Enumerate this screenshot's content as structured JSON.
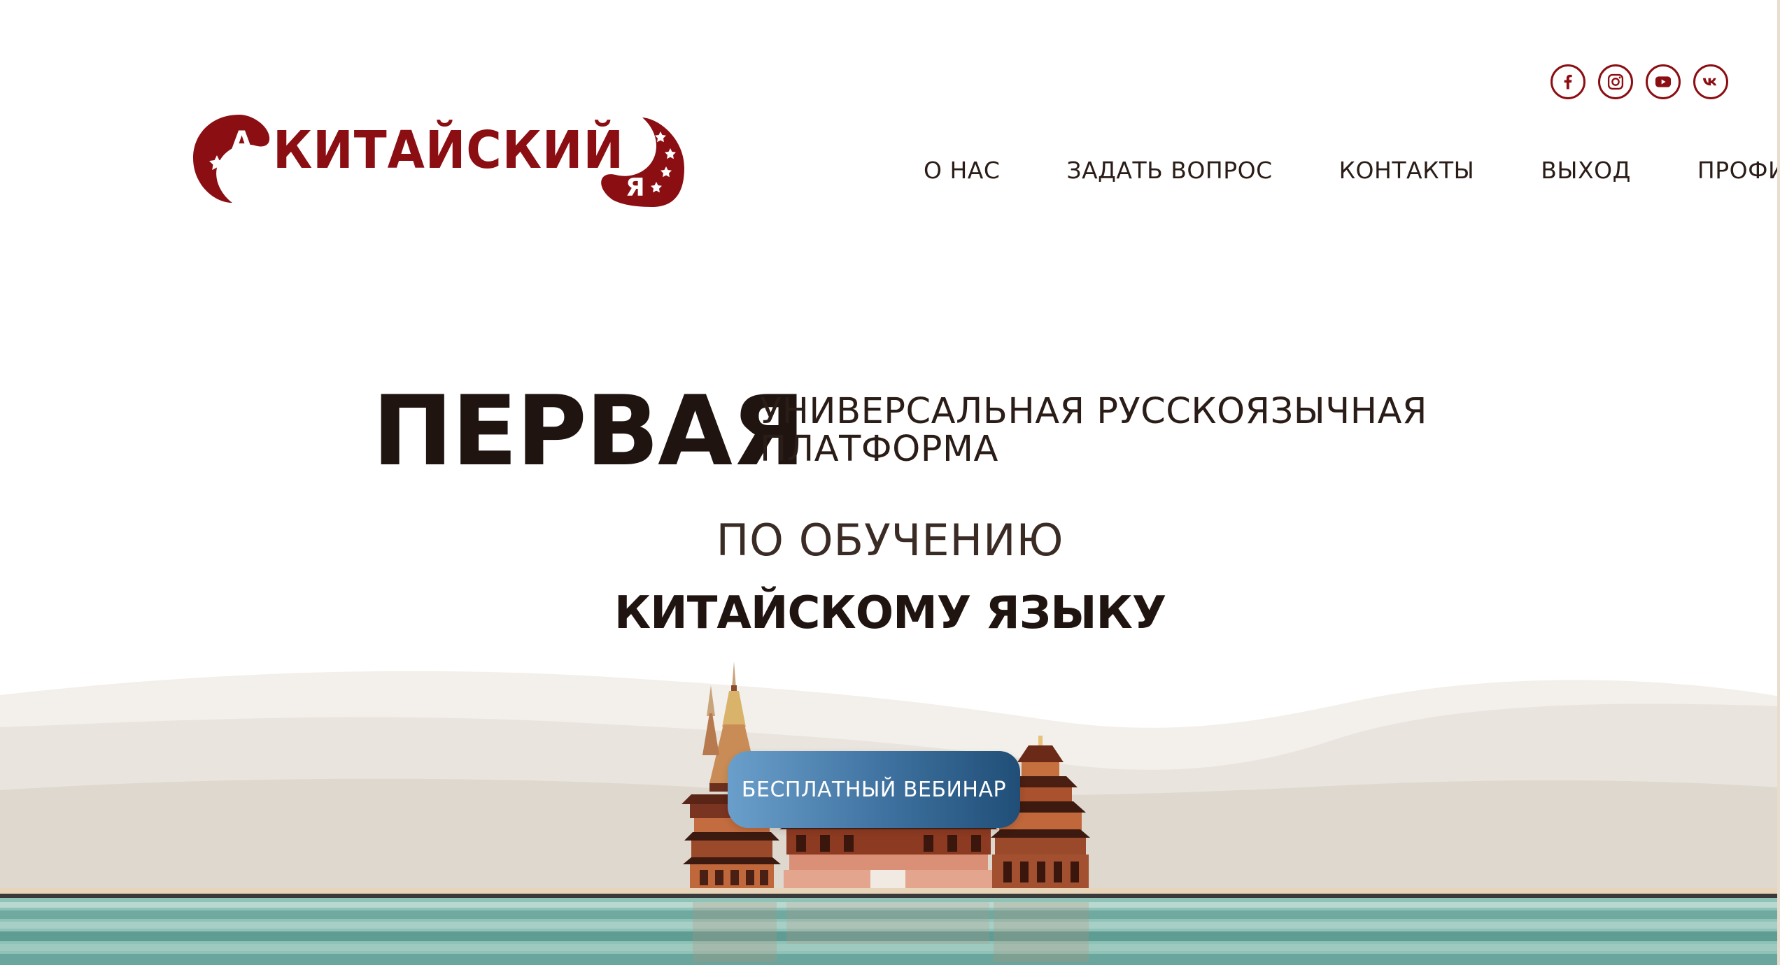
{
  "logo": {
    "word": "КИТАЙСКИЙ",
    "letter_a": "А",
    "letter_ya": "Я"
  },
  "socials": [
    {
      "name": "facebook",
      "icon": "facebook-icon"
    },
    {
      "name": "instagram",
      "icon": "instagram-icon"
    },
    {
      "name": "youtube",
      "icon": "youtube-icon"
    },
    {
      "name": "vk",
      "icon": "vk-icon"
    }
  ],
  "nav": {
    "items": [
      {
        "label": "О НАС"
      },
      {
        "label": "ЗАДАТЬ ВОПРОС"
      },
      {
        "label": "КОНТАКТЫ"
      },
      {
        "label": "ВЫХОД"
      },
      {
        "label": "ПРОФИЛЬ"
      }
    ]
  },
  "hero": {
    "big": "ПЕРВАЯ",
    "small_line1": "УНИВЕРСАЛЬНАЯ РУССКОЯЗЫЧНАЯ",
    "small_line2": "ПЛАТФОРМА",
    "mid": "ПО ОБУЧЕНИЮ",
    "bold": "КИТАЙСКОМУ ЯЗЫКУ"
  },
  "cta": {
    "label": "БЕСПЛАТНЫЙ ВЕБИНАР"
  },
  "colors": {
    "brand": "#8b0e13",
    "cta_start": "#6b9fcb",
    "cta_end": "#204e77",
    "water": "#7fb5ad"
  }
}
